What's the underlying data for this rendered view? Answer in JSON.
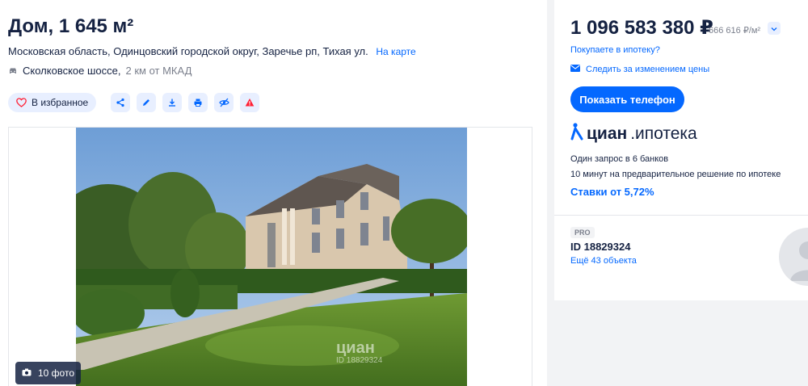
{
  "listing": {
    "title": "Дом, 1 645 м²",
    "address": "Московская область, Одинцовский городской округ, Заречье рп, Тихая ул.",
    "map_link": "На карте",
    "highway": "Сколковское шоссе,",
    "highway_distance": "2 км от МКАД"
  },
  "actions": {
    "favorite_label": "В избранное",
    "icons": [
      "heart-icon",
      "share-icon",
      "edit-icon",
      "download-icon",
      "print-icon",
      "hide-icon",
      "warning-icon"
    ]
  },
  "gallery": {
    "photo_count": "10 фото",
    "watermark_brand": "циан",
    "watermark_id": "ID 18829324"
  },
  "price": {
    "value": "1 096 583 380 ₽",
    "per_meter": "666 616 ₽/м²",
    "mortgage_question": "Покупаете в ипотеку?",
    "follow_price": "Следить за изменением цены",
    "show_phone": "Показать телефон"
  },
  "mortgage_promo": {
    "brand": "циан",
    "product": ".ипотека",
    "banks_line": "Один запрос в 6 банков",
    "decision_line": "10 минут на предварительное решение по ипотеке",
    "rates": "Ставки от 5,72%"
  },
  "agent": {
    "badge": "PRO",
    "id": "ID 18829324",
    "more_objects": "Ещё 43 объекта"
  },
  "colors": {
    "accent": "#0468ff",
    "text": "#152242",
    "muted": "#7a7f8c",
    "danger": "#ff1f34",
    "chip_bg": "#e8efff"
  }
}
